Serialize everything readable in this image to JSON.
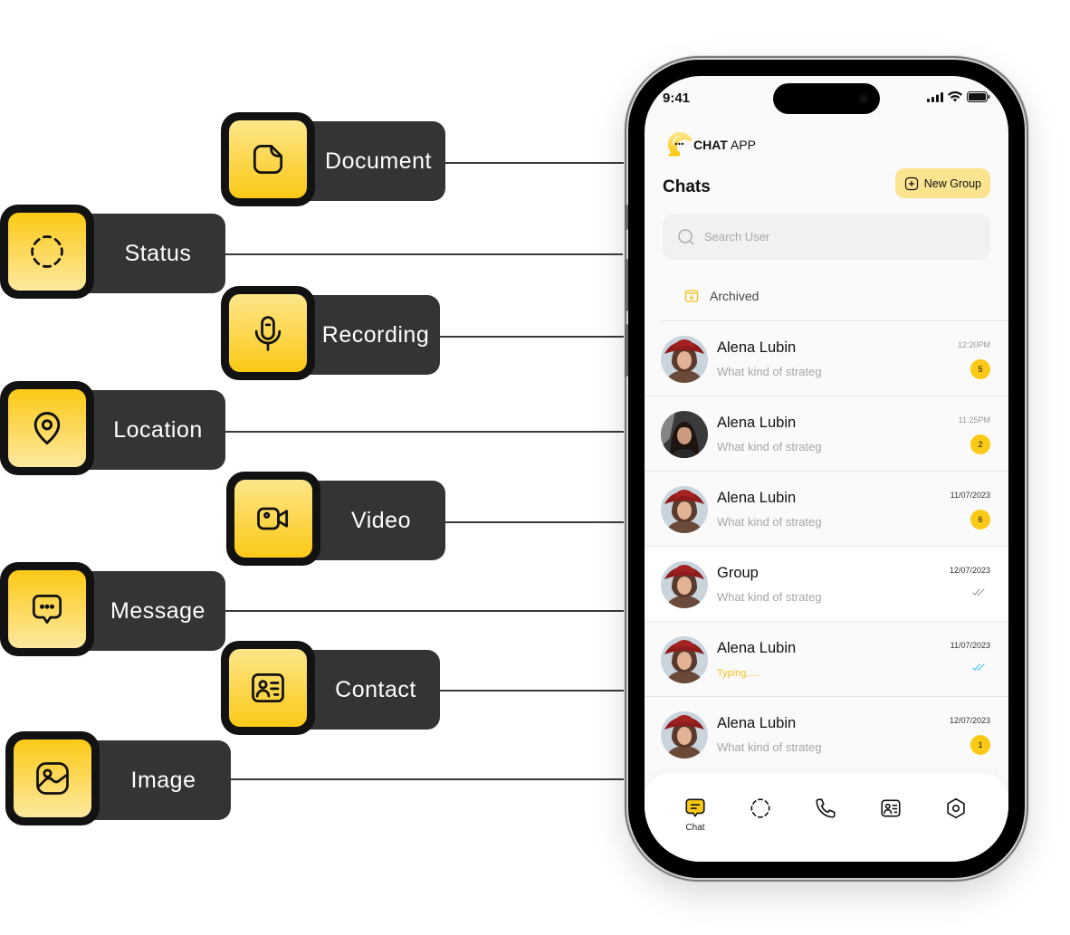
{
  "features": [
    {
      "label": "Document",
      "icon": "document-icon"
    },
    {
      "label": "Status",
      "icon": "status-icon"
    },
    {
      "label": "Recording",
      "icon": "microphone-icon"
    },
    {
      "label": "Location",
      "icon": "location-pin-icon"
    },
    {
      "label": "Video",
      "icon": "video-camera-icon"
    },
    {
      "label": "Message",
      "icon": "message-bubble-icon"
    },
    {
      "label": "Contact",
      "icon": "contact-card-icon"
    },
    {
      "label": "Image",
      "icon": "image-icon"
    }
  ],
  "colors": {
    "accent": "#fcc916",
    "accent_light": "#fbe48f",
    "pill_bg": "#343434",
    "typing": "#f5c11c",
    "read_ticks": "#5ec8f0"
  },
  "phone": {
    "status_bar": {
      "time": "9:41"
    },
    "brand": {
      "bold": "CHAT",
      "regular": " APP"
    },
    "header": {
      "title": "Chats",
      "new_group_label": "New Group"
    },
    "search": {
      "placeholder": "Search User",
      "value": ""
    },
    "archived_label": "Archived",
    "chats": [
      {
        "name": "Alena Lubin",
        "preview": "What kind of strateg",
        "time": "12:20PM",
        "unread": "5",
        "status": "unread"
      },
      {
        "name": "Alena Lubin",
        "preview": "What kind of strateg",
        "time": "11:25PM",
        "unread": "2",
        "status": "unread"
      },
      {
        "name": "Alena Lubin",
        "preview": "What kind of strateg",
        "time": "11/07/2023",
        "unread": "6",
        "status": "unread"
      },
      {
        "name": "Group",
        "preview": "What kind of strateg",
        "time": "12/07/2023",
        "unread": null,
        "status": "delivered"
      },
      {
        "name": "Alena Lubin",
        "preview": "Typing.....",
        "time": "11/07/2023",
        "unread": null,
        "status": "read"
      },
      {
        "name": "Alena Lubin",
        "preview": "What kind of strateg",
        "time": "12/07/2023",
        "unread": "1",
        "status": "unread"
      }
    ],
    "tabbar": [
      {
        "label": "Chat",
        "icon": "chat-icon",
        "active": true
      },
      {
        "label": "",
        "icon": "status-icon",
        "active": false
      },
      {
        "label": "",
        "icon": "phone-icon",
        "active": false
      },
      {
        "label": "",
        "icon": "contact-card-icon",
        "active": false
      },
      {
        "label": "",
        "icon": "settings-icon",
        "active": false
      }
    ]
  }
}
